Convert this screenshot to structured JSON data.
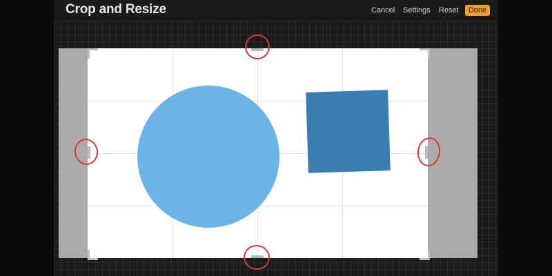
{
  "header": {
    "title": "Crop and Resize",
    "cancel_label": "Cancel",
    "settings_label": "Settings",
    "reset_label": "Reset",
    "done_label": "Done"
  },
  "colors": {
    "accent": "#f0a030",
    "circle": "#6cb4e8",
    "square": "#3d7eb2",
    "annotation": "#d6393b",
    "outside_crop": "#ababab"
  }
}
